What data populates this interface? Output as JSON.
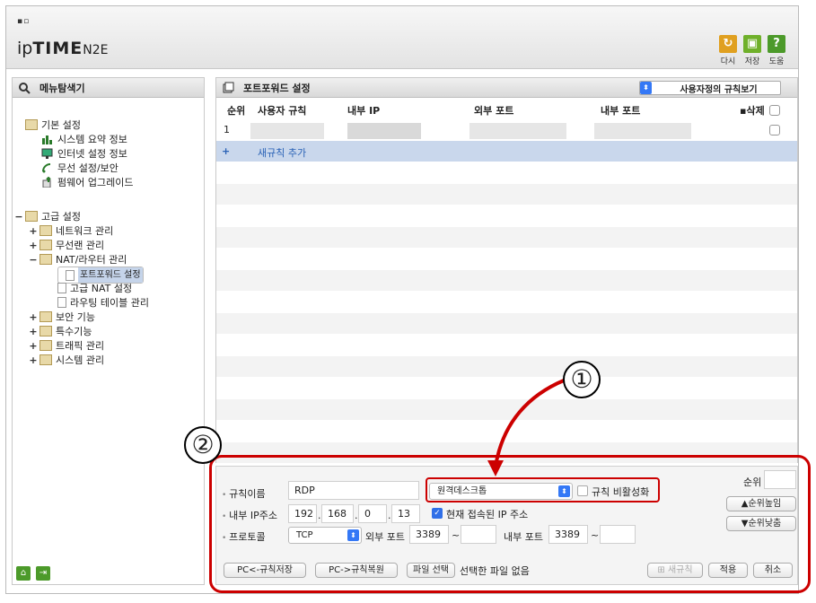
{
  "header": {
    "logo_dots": "▪▫",
    "logo_ip": "ip",
    "logo_time": "TIME",
    "logo_model": "N2E",
    "buttons": [
      {
        "label": "다시",
        "icon": "refresh-icon",
        "color": "#e0a020"
      },
      {
        "label": "저장",
        "icon": "save-icon",
        "color": "#6fb02a"
      },
      {
        "label": "도움",
        "icon": "help-icon",
        "color": "#4c9a2a",
        "glyph": "?"
      }
    ]
  },
  "sidebar": {
    "title": "메뉴탐색기",
    "groups": [
      {
        "label": "기본 설정",
        "items": [
          "시스템 요약 정보",
          "인터넷 설정 정보",
          "무선 설정/보안",
          "펌웨어 업그레이드"
        ]
      },
      {
        "label": "고급 설정",
        "items": [
          "네트워크 관리",
          "무선랜 관리",
          "NAT/라우터 관리",
          "포트포워드 설정",
          "고급 NAT 설정",
          "라우팅 테이블 관리",
          "보안 기능",
          "특수기능",
          "트래픽 관리",
          "시스템 관리"
        ]
      }
    ],
    "expand_plus": "+",
    "expand_minus": "−"
  },
  "main": {
    "title": "포트포워드 설정",
    "view_select": "사용자정의 규칙보기",
    "columns": {
      "order": "순위",
      "rule": "사용자 규칙",
      "internal_ip": "내부 IP",
      "external_port": "외부 포트",
      "internal_port": "내부 포트",
      "delete": "삭제"
    },
    "rows": [
      {
        "order": "1"
      }
    ],
    "add_rule": {
      "plus": "+",
      "label": "새규칙 추가"
    }
  },
  "form": {
    "rule_name_label": "규칙이름",
    "rule_name_value": "RDP",
    "preset_select": "원격데스크톱",
    "disable_rule_label": "규칙 비활성화",
    "internal_ip_label": "내부 IP주소",
    "ip_octets": [
      "192",
      "168",
      "0",
      "13"
    ],
    "current_ip_label": "현재 접속된 IP 주소",
    "protocol_label": "프로토콜",
    "protocol_value": "TCP",
    "external_port_label": "외부 포트",
    "external_port_from": "3389",
    "external_port_to": "",
    "internal_port_label": "내부 포트",
    "internal_port_from": "3389",
    "internal_port_to": "",
    "tilde": "~",
    "order_label": "순위",
    "order_value": "",
    "order_up": "▲순위높임",
    "order_down": "▼순위낮춤",
    "pc_save": "PC<-규칙저장",
    "pc_restore": "PC->규칙복원",
    "file_select": "파일 선택",
    "no_file": "선택한 파일 없음",
    "new_rule": "새규칙",
    "apply": "적용",
    "cancel": "취소"
  },
  "annotations": {
    "one": "①",
    "two": "②",
    "highlight_color": "#cc0000"
  }
}
